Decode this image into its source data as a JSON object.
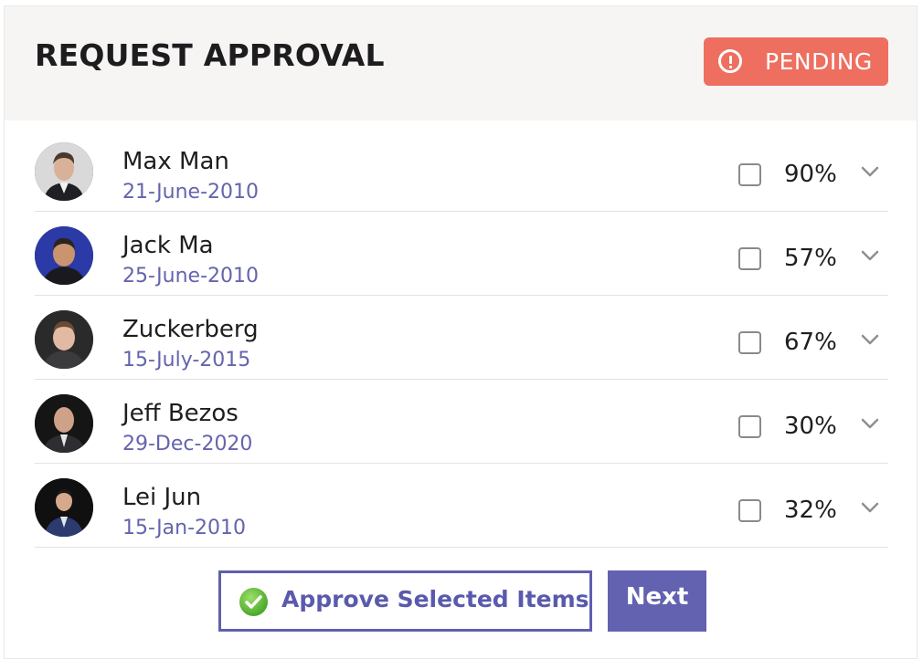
{
  "header": {
    "title": "REQUEST APPROVAL",
    "status_badge": {
      "label": "PENDING",
      "icon": "alert-circle-icon",
      "color": "#ee6f60"
    }
  },
  "requests": [
    {
      "name": "Max Man",
      "date": "21-June-2010",
      "percent": "90%",
      "checked": false
    },
    {
      "name": "Jack Ma",
      "date": "25-June-2010",
      "percent": "57%",
      "checked": false
    },
    {
      "name": "Zuckerberg",
      "date": "15-July-2015",
      "percent": "67%",
      "checked": false
    },
    {
      "name": "Jeff Bezos",
      "date": "29-Dec-2020",
      "percent": "30%",
      "checked": false
    },
    {
      "name": "Lei Jun",
      "date": "15-Jan-2010",
      "percent": "32%",
      "checked": false
    }
  ],
  "actions": {
    "approve_label": "Approve Selected Items",
    "approve_icon": "check-circle-icon",
    "next_label": "Next"
  },
  "colors": {
    "accent": "#6262b0",
    "date_text": "#6464ad",
    "badge": "#ee6f60",
    "header_bg": "#f7f5f4"
  }
}
